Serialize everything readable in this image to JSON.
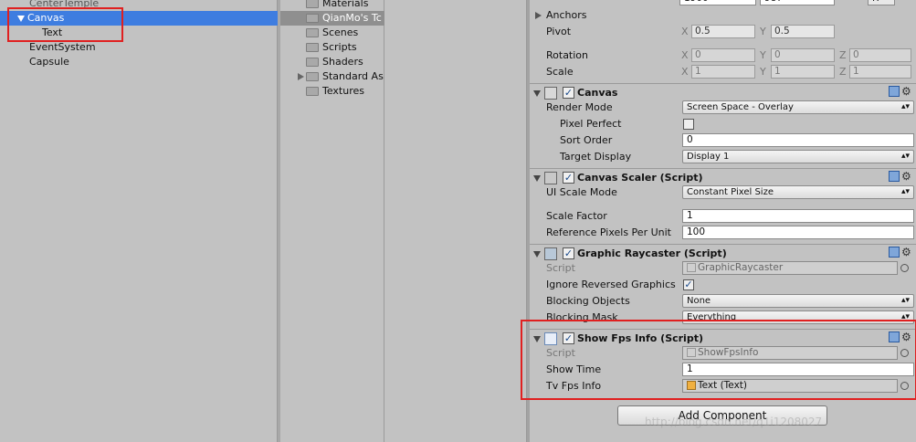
{
  "hierarchy": {
    "items": [
      {
        "label": "CenterTemple"
      },
      {
        "label": "Canvas"
      },
      {
        "label": "Text"
      },
      {
        "label": "EventSystem"
      },
      {
        "label": "Capsule"
      }
    ]
  },
  "project": {
    "items": [
      {
        "label": "Materials"
      },
      {
        "label": "QianMo's Tc"
      },
      {
        "label": "Scenes"
      },
      {
        "label": "Scripts"
      },
      {
        "label": "Shaders"
      },
      {
        "label": "Standard As"
      },
      {
        "label": "Textures"
      }
    ]
  },
  "inspector": {
    "top_partial": {
      "v1": "1900",
      "v2": "987"
    },
    "anchors_label": "Anchors",
    "pivot": {
      "label": "Pivot",
      "x_axis": "X",
      "x": "0.5",
      "y_axis": "Y",
      "y": "0.5"
    },
    "rotation": {
      "label": "Rotation",
      "x_axis": "X",
      "x": "0",
      "y_axis": "Y",
      "y": "0",
      "z_axis": "Z",
      "z": "0"
    },
    "scale": {
      "label": "Scale",
      "x_axis": "X",
      "x": "1",
      "y_axis": "Y",
      "y": "1",
      "z_axis": "Z",
      "z": "1"
    },
    "canvas": {
      "title": "Canvas",
      "render_mode_label": "Render Mode",
      "render_mode_value": "Screen Space - Overlay",
      "pixel_perfect_label": "Pixel Perfect",
      "sort_order_label": "Sort Order",
      "sort_order_value": "0",
      "target_display_label": "Target Display",
      "target_display_value": "Display 1"
    },
    "scaler": {
      "title": "Canvas Scaler (Script)",
      "ui_scale_mode_label": "UI Scale Mode",
      "ui_scale_mode_value": "Constant Pixel Size",
      "scale_factor_label": "Scale Factor",
      "scale_factor_value": "1",
      "ref_ppu_label": "Reference Pixels Per Unit",
      "ref_ppu_value": "100"
    },
    "raycaster": {
      "title": "Graphic Raycaster (Script)",
      "script_label": "Script",
      "script_value": "GraphicRaycaster",
      "ignore_label": "Ignore Reversed Graphics",
      "blocking_objects_label": "Blocking Objects",
      "blocking_objects_value": "None",
      "blocking_mask_label": "Blocking Mask",
      "blocking_mask_value": "Everything"
    },
    "fps": {
      "title": "Show Fps Info (Script)",
      "script_label": "Script",
      "script_value": "ShowFpsInfo",
      "show_time_label": "Show Time",
      "show_time_value": "1",
      "tv_label": "Tv Fps Info",
      "tv_value": "Text (Text)"
    },
    "add_component": "Add Component",
    "watermark": "http://blog.csdn.net/q1i1208027"
  },
  "colors": {
    "selection": "#3e7de0",
    "highlight_box": "#e02020"
  }
}
